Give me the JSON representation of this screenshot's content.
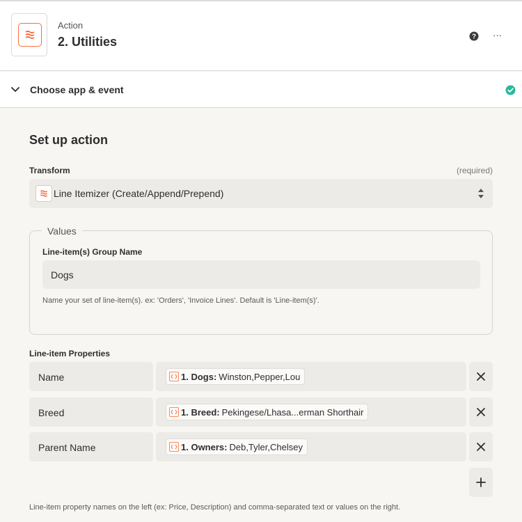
{
  "header": {
    "kicker": "Action",
    "title": "2. Utilities",
    "help_icon": "question-circle-icon",
    "more_icon": "ellipsis-icon",
    "more_glyph": "···"
  },
  "section": {
    "label": "Choose app & event",
    "status_icon": "check-circle-icon",
    "status_color": "#2bb89a"
  },
  "setup": {
    "title": "Set up action",
    "transform": {
      "label": "Transform",
      "required": "(required)",
      "selected": "Line Itemizer (Create/Append/Prepend)"
    },
    "values": {
      "legend": "Values",
      "group_name_label": "Line-item(s) Group Name",
      "group_name_value": "Dogs",
      "group_name_hint": "Name your set of line-item(s). ex: 'Orders', 'Invoice Lines'. Default is 'Line-item(s)'."
    },
    "properties": {
      "label": "Line-item Properties",
      "rows": [
        {
          "key": "Name",
          "step": "1. Dogs:",
          "value": "Winston,Pepper,Lou"
        },
        {
          "key": "Breed",
          "step": "1. Breed:",
          "value": "Pekingese/Lhasa...erman Shorthair"
        },
        {
          "key": "Parent Name",
          "step": "1. Owners:",
          "value": "Deb,Tyler,Chelsey"
        }
      ],
      "hint": "Line-item property names on the left (ex: Price, Description) and comma-separated text or values on the right."
    }
  },
  "colors": {
    "accent": "#ff4f00",
    "field_bg": "#ecebe8",
    "page_bg": "#f7f6f2"
  }
}
